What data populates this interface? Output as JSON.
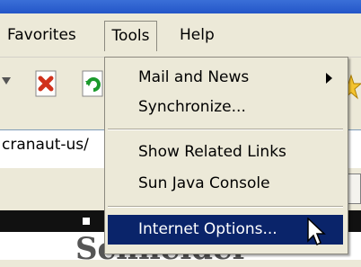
{
  "menubar": {
    "favorites": "Favorites",
    "tools": "Tools",
    "help": "Help"
  },
  "address": {
    "text": "cranaut-us/"
  },
  "tools_menu": {
    "items": [
      {
        "label": "Mail and News",
        "has_submenu": true
      },
      {
        "label": "Synchronize..."
      },
      {
        "label": "Show Related Links"
      },
      {
        "label": "Sun Java Console"
      },
      {
        "label": "Internet Options...",
        "highlighted": true
      }
    ]
  },
  "page": {
    "big_text": "Schneider"
  },
  "colors": {
    "titlebar": "#2456c8",
    "menu_bg": "#ece9d8",
    "highlight": "#0a246a"
  }
}
